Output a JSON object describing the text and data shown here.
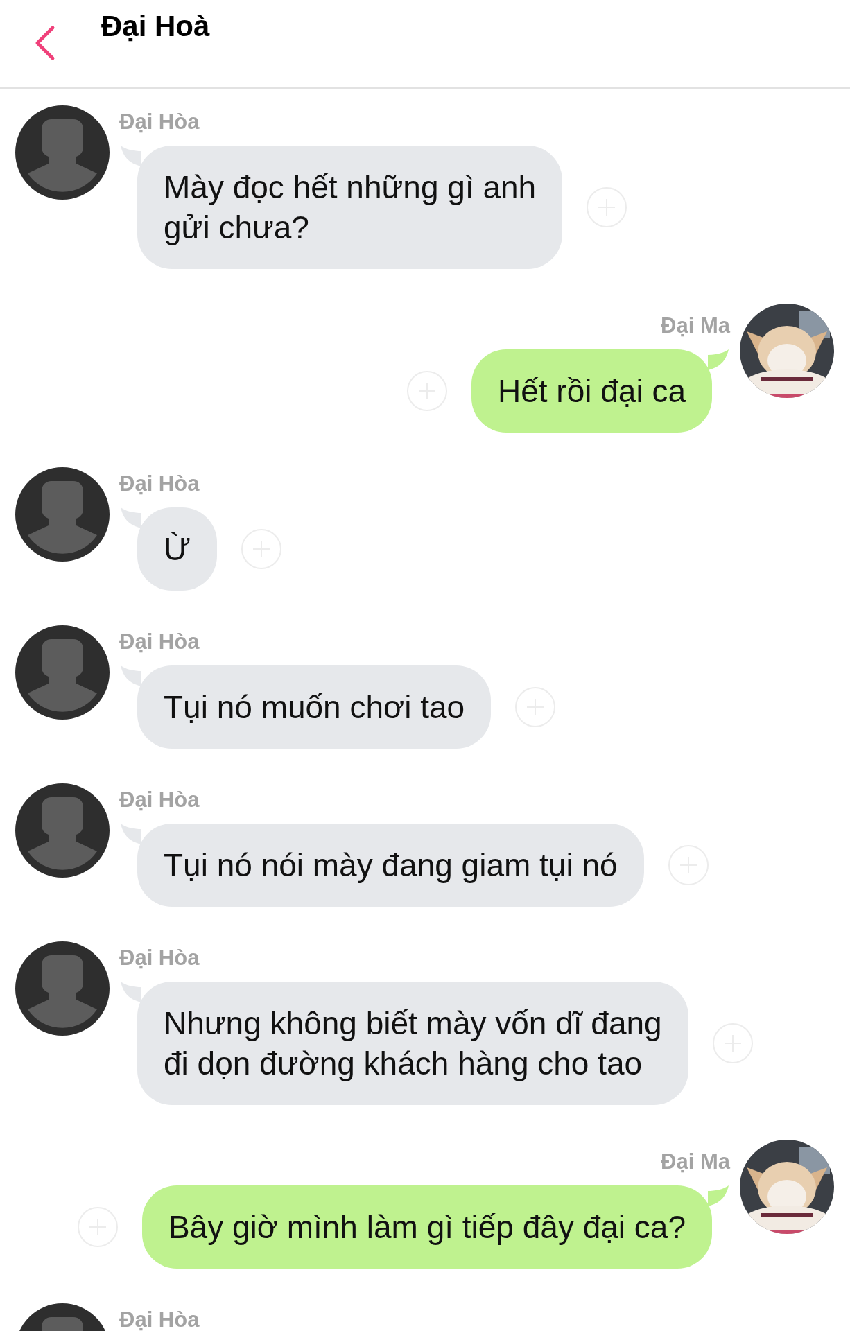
{
  "header": {
    "title": "Đại Hoà"
  },
  "messages": [
    {
      "kind": "incoming",
      "sender": "Đại Hòa",
      "text": "Mày đọc hết những gì anh\ngửi chưa?"
    },
    {
      "kind": "outgoing",
      "sender": "Đại Ma",
      "text": "Hết rồi đại ca"
    },
    {
      "kind": "incoming",
      "sender": "Đại Hòa",
      "text": "Ừ"
    },
    {
      "kind": "incoming",
      "sender": "Đại Hòa",
      "text": "Tụi nó muốn chơi tao"
    },
    {
      "kind": "incoming",
      "sender": "Đại Hòa",
      "text": "Tụi nó nói mày đang giam tụi nó"
    },
    {
      "kind": "incoming",
      "sender": "Đại Hòa",
      "text": "Nhưng không biết mày vốn dĩ đang\nđi dọn đường khách hàng cho tao"
    },
    {
      "kind": "outgoing",
      "sender": "Đại Ma",
      "text": "Bây giờ mình làm gì tiếp đây đại ca?"
    },
    {
      "kind": "incoming",
      "sender": "Đại Hòa"
    }
  ]
}
